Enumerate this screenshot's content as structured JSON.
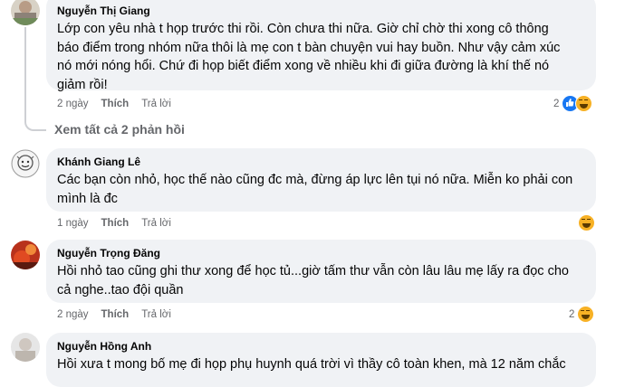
{
  "comments": [
    {
      "author": "Nguyễn Thị Giang",
      "lines": [
        "Lớp con yêu nhà t họp trước thi rồi. Còn chưa thi nữa. Giờ chỉ chờ thi xong cô thông",
        "báo điểm trong nhóm nữa thôi là mẹ con t bàn chuyện vui hay buồn. Như vậy cảm xúc",
        "nó mới nóng hổi. Chứ đi họp biết điểm xong về nhiều khi đi giữa đường là khí thế nó",
        "giảm rồi!"
      ],
      "time": "2 ngày",
      "like": "Thích",
      "reply": "Trả lời",
      "reaction_count": "2"
    },
    {
      "author": "Khánh Giang Lê",
      "lines": [
        "Các bạn còn nhỏ, học thế nào cũng đc mà, đừng áp lực lên tụi nó nữa. Miễn ko phải con",
        "mình là đc"
      ],
      "time": "1 ngày",
      "like": "Thích",
      "reply": "Trả lời",
      "reaction_count": ""
    },
    {
      "author": "Nguyễn Trọng Đăng",
      "lines": [
        "Hồi nhỏ tao cũng ghi thư xong để học tủ...giờ tấm thư vẫn còn lâu lâu mẹ lấy ra đọc cho",
        "cả nghe..tao đội quần"
      ],
      "time": "2 ngày",
      "like": "Thích",
      "reply": "Trả lời",
      "reaction_count": "2"
    },
    {
      "author": "Nguyễn Hồng Anh",
      "lines": [
        "Hồi xưa t mong bố mẹ đi họp phụ huynh quá trời vì thầy cô toàn khen, mà 12 năm chắc"
      ]
    }
  ],
  "view_replies": "Xem tất cả 2 phản hồi",
  "colors": {
    "bubble": "#f0f2f5",
    "like_blue": "#1877f2",
    "haha_yellow": "#f7b125",
    "meta_gray": "#65676b"
  },
  "icons": [
    "like-reaction-icon",
    "haha-reaction-icon"
  ]
}
